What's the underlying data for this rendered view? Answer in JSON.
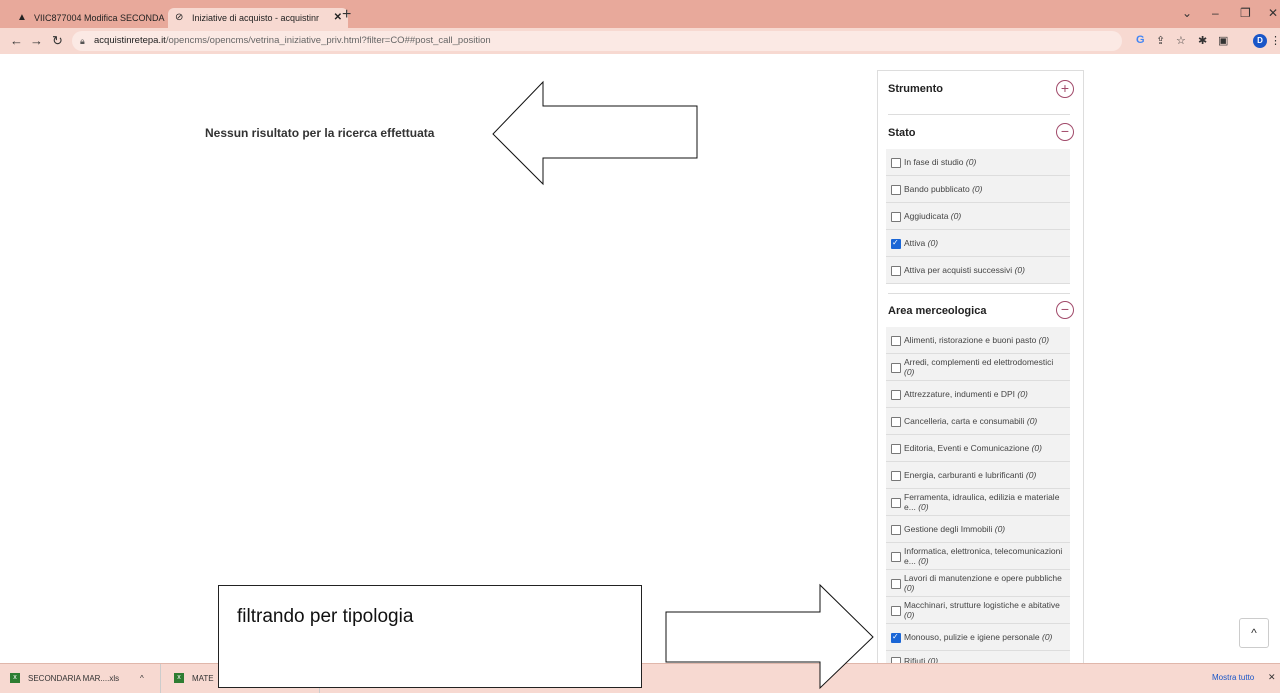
{
  "browser": {
    "tabs": [
      {
        "title": "VIIC877004 Modifica SECONDA",
        "close": "✕"
      },
      {
        "title": "Iniziative di acquisto - acquistinr",
        "close": "✕"
      }
    ],
    "new_tab": "+",
    "url_domain": "acquistinretepa.it",
    "url_path": "/opencms/opencms/vetrina_iniziative_priv.html?filter=CO##post_call_position",
    "profile_initial": "D"
  },
  "main": {
    "no_results": "Nessun risultato per la ricerca effettuata"
  },
  "filters": {
    "strumento": {
      "title": "Strumento",
      "toggle": "+"
    },
    "stato": {
      "title": "Stato",
      "toggle": "−",
      "options": [
        {
          "label": "In fase di studio",
          "count": "(0)",
          "checked": false
        },
        {
          "label": "Bando pubblicato",
          "count": "(0)",
          "checked": false
        },
        {
          "label": "Aggiudicata",
          "count": "(0)",
          "checked": false
        },
        {
          "label": "Attiva",
          "count": "(0)",
          "checked": true
        },
        {
          "label": "Attiva per acquisti successivi",
          "count": "(0)",
          "checked": false
        }
      ]
    },
    "area": {
      "title": "Area merceologica",
      "toggle": "−",
      "options": [
        {
          "label": "Alimenti, ristorazione e buoni pasto",
          "count": "(0)",
          "checked": false
        },
        {
          "label": "Arredi, complementi ed elettrodomestici",
          "count": "(0)",
          "checked": false
        },
        {
          "label": "Attrezzature, indumenti e DPI",
          "count": "(0)",
          "checked": false
        },
        {
          "label": "Cancelleria, carta e consumabili",
          "count": "(0)",
          "checked": false
        },
        {
          "label": "Editoria, Eventi e Comunicazione",
          "count": "(0)",
          "checked": false
        },
        {
          "label": "Energia, carburanti e lubrificanti",
          "count": "(0)",
          "checked": false
        },
        {
          "label": "Ferramenta, idraulica, edilizia e materiale e...",
          "count": "(0)",
          "checked": false
        },
        {
          "label": "Gestione degli Immobili",
          "count": "(0)",
          "checked": false
        },
        {
          "label": "Informatica, elettronica, telecomunicazioni e...",
          "count": "(0)",
          "checked": false
        },
        {
          "label": "Lavori di manutenzione e opere pubbliche",
          "count": "(0)",
          "checked": false
        },
        {
          "label": "Macchinari, strutture logistiche e abitative",
          "count": "(0)",
          "checked": false
        },
        {
          "label": "Monouso, pulizie e igiene personale",
          "count": "(0)",
          "checked": true
        },
        {
          "label": "Rifiuti",
          "count": "(0)",
          "checked": false
        }
      ]
    }
  },
  "downloads": {
    "item1": "SECONDARIA MAR....xls",
    "item2": "MATE",
    "show_all": "Mostra tutto"
  },
  "annotation": {
    "text": "filtrando per tipologia"
  }
}
